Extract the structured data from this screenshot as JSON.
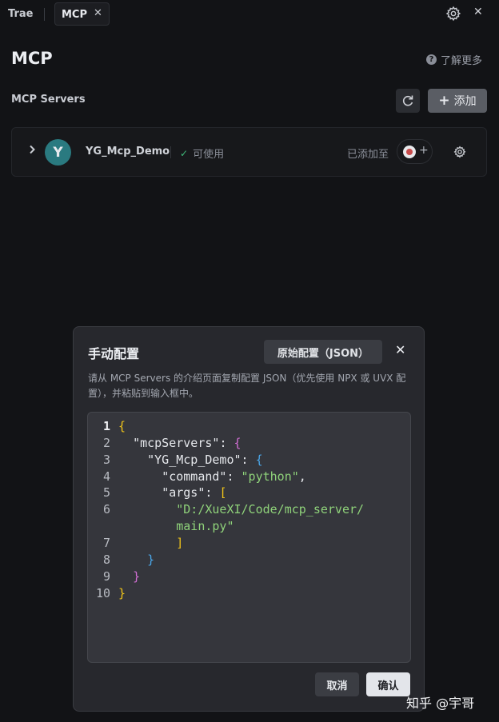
{
  "tabbar": {
    "app_name": "Trae",
    "tab_label": "MCP",
    "tab_close": "✕",
    "window_close": "✕"
  },
  "header": {
    "title": "MCP",
    "learn_more": "了解更多"
  },
  "servers_section": {
    "title": "MCP Servers",
    "add_label": "添加"
  },
  "server": {
    "avatar_letter": "Y",
    "name": "YG_Mcp_Demo",
    "status": "可使用",
    "added_to": "已添加至"
  },
  "dialog": {
    "title": "手动配置",
    "raw_config_button": "原始配置（JSON）",
    "close": "✕",
    "description": "请从 MCP Servers 的介绍页面复制配置 JSON（优先使用 NPX 或 UVX 配置），并粘贴到输入框中。",
    "line_numbers": [
      "1",
      "2",
      "3",
      "4",
      "5",
      "6",
      "",
      "7",
      "8",
      "9",
      "10"
    ],
    "code": {
      "l1_brace": "{",
      "l2_key": "\"mcpServers\"",
      "l2_colon": ": ",
      "l2_brace": "{",
      "l3_key": "\"YG_Mcp_Demo\"",
      "l3_colon": ": ",
      "l3_brace": "{",
      "l4_key": "\"command\"",
      "l4_colon": ": ",
      "l4_value": "\"python\"",
      "l4_comma": ",",
      "l5_key": "\"args\"",
      "l5_colon": ": ",
      "l5_bracket": "[",
      "l6_value": "\"D:/XueXI/Code/mcp_server/",
      "l6b_value": "main.py\"",
      "l7_bracket": "]",
      "l8_brace": "}",
      "l9_brace": "}",
      "l10_brace": "}"
    },
    "cancel_label": "取消",
    "confirm_label": "确认"
  },
  "watermark": "知乎 @宇哥",
  "colors": {
    "background": "#121316",
    "dialog": "#27282d",
    "editor": "#35363c",
    "status_ok": "#3fb97a",
    "avatar": "#2a7a80",
    "json_brace_yellow": "#f0c419",
    "json_brace_magenta": "#d36fd6",
    "json_brace_blue": "#4aa6e8",
    "json_string": "#8fd27a"
  },
  "icons": {
    "settings": "gear-icon",
    "help": "question-circle-icon",
    "refresh": "refresh-icon",
    "add": "plus-icon",
    "expand": "chevron-right-icon",
    "status": "check-icon"
  }
}
